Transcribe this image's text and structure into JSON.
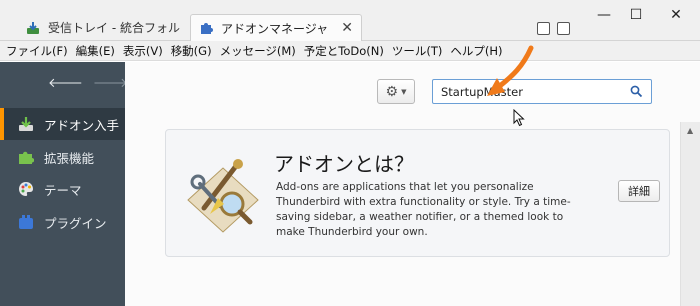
{
  "tabs": [
    {
      "label": "受信トレイ - 統合フォルダ",
      "icon": "inbox-download-icon"
    },
    {
      "label": "アドオンマネージャ",
      "icon": "puzzle-piece-icon",
      "close": "✕"
    }
  ],
  "window": {
    "minimize": "—",
    "maximize": "☐",
    "close": "✕"
  },
  "menubar": [
    "ファイル(F)",
    "編集(E)",
    "表示(V)",
    "移動(G)",
    "メッセージ(M)",
    "予定とToDo(N)",
    "ツール(T)",
    "ヘルプ(H)"
  ],
  "sidebar": {
    "back": "🡐",
    "forward": "🡒",
    "categories": [
      {
        "label": "アドオン入手",
        "icon": "download-addon-icon",
        "selected": true
      },
      {
        "label": "拡張機能",
        "icon": "puzzle-piece-icon"
      },
      {
        "label": "テーマ",
        "icon": "paint-palette-icon"
      },
      {
        "label": "プラグイン",
        "icon": "plugin-brick-icon"
      }
    ]
  },
  "toolbar": {
    "gear": "⚙",
    "caret": "▼"
  },
  "search": {
    "value": "StartupMaster"
  },
  "card": {
    "title": "アドオンとは？",
    "description": "Add-ons are applications that let you personalize Thunderbird with extra functionality or style. Try a time-saving sidebar, a weather notifier, or a themed look to make Thunderbird your own.",
    "details_button": "詳細"
  },
  "colors": {
    "sidebar": "#424f5a",
    "selected_accent": "#ff9500",
    "annotation_arrow": "#f07a1a"
  }
}
